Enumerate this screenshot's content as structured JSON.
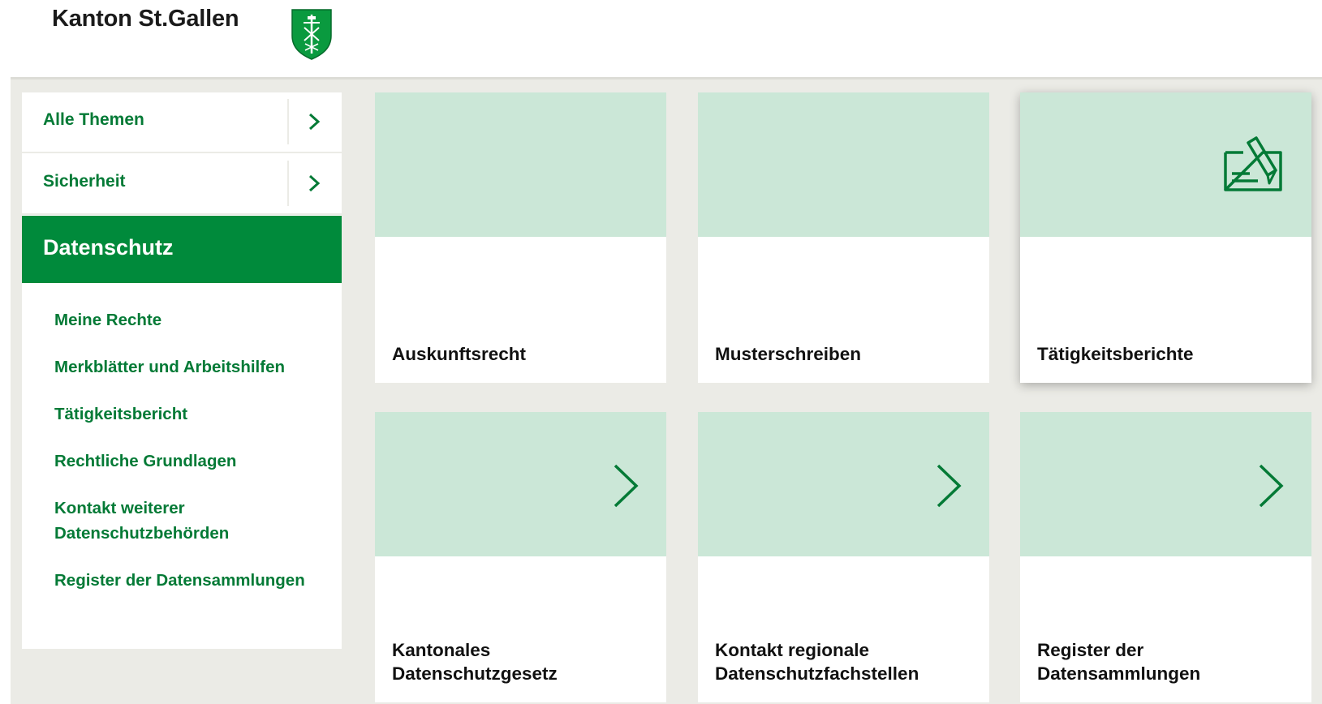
{
  "header": {
    "brand": "Kanton St.Gallen",
    "crest_icon": "st-gallen-crest-icon"
  },
  "sidebar": {
    "items": [
      {
        "label": "Alle Themen",
        "icon": "chevron-right-icon"
      },
      {
        "label": "Sicherheit",
        "icon": "chevron-right-icon"
      }
    ],
    "active": {
      "label": "Datenschutz"
    },
    "subitems": [
      "Meine Rechte",
      "Merkblätter und Arbeitshilfen",
      "Tätigkeitsbericht",
      "Rechtliche Grundlagen",
      "Kontakt weiterer Datenschutzbehörden",
      "Register der Datensammlungen"
    ]
  },
  "tiles": [
    {
      "title": "Auskunftsrecht"
    },
    {
      "title": "Musterschreiben"
    },
    {
      "title": "Tätigkeitsberichte",
      "icon": "document-edit-icon"
    },
    {
      "title": "Kantonales Datenschutzgesetz",
      "icon": "chevron-right-icon"
    },
    {
      "title": "Kontakt regionale Datenschutzfachstellen",
      "icon": "chevron-right-icon"
    },
    {
      "title": "Register der Datensammlungen",
      "icon": "chevron-right-icon"
    }
  ],
  "colors": {
    "brand_green": "#008a3b",
    "link_green": "#047a36",
    "tile_mint": "#cbe7d7",
    "background": "#ebebe6"
  }
}
